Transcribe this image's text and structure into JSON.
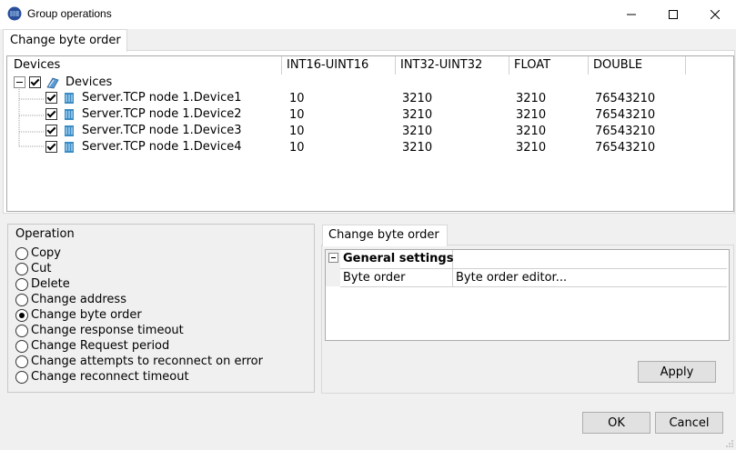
{
  "window": {
    "title": "Group operations",
    "controls": {
      "minimize": "—",
      "maximize": "☐",
      "close": "✕"
    }
  },
  "outer_tab": {
    "label": "Change byte order"
  },
  "devices_table": {
    "columns": [
      "Devices",
      "INT16-UINT16",
      "INT32-UINT32",
      "FLOAT",
      "DOUBLE"
    ],
    "root": {
      "label": "Devices",
      "expander": "⊟"
    },
    "rows": [
      {
        "name": "Server.TCP node 1.Device1",
        "int16": "10",
        "int32": "3210",
        "float": "3210",
        "double": "76543210"
      },
      {
        "name": "Server.TCP node 1.Device2",
        "int16": "10",
        "int32": "3210",
        "float": "3210",
        "double": "76543210"
      },
      {
        "name": "Server.TCP node 1.Device3",
        "int16": "10",
        "int32": "3210",
        "float": "3210",
        "double": "76543210"
      },
      {
        "name": "Server.TCP node 1.Device4",
        "int16": "10",
        "int32": "3210",
        "float": "3210",
        "double": "76543210"
      }
    ]
  },
  "operation": {
    "title": "Operation",
    "options": [
      "Copy",
      "Cut",
      "Delete",
      "Change address",
      "Change byte order",
      "Change response timeout",
      "Change Request period",
      "Change attempts to reconnect on error",
      "Change reconnect timeout"
    ],
    "selected": "Change byte order"
  },
  "right_tab": {
    "label": "Change byte order"
  },
  "settings": {
    "section": "General settings",
    "expander": "⊟",
    "property": "Byte order",
    "value": "Byte order editor..."
  },
  "buttons": {
    "apply": "Apply",
    "ok": "OK",
    "cancel": "Cancel"
  },
  "colors": {
    "background": "#f0f0f0",
    "device_icon": "#2f7fb8",
    "accent": "#3c78c8"
  }
}
